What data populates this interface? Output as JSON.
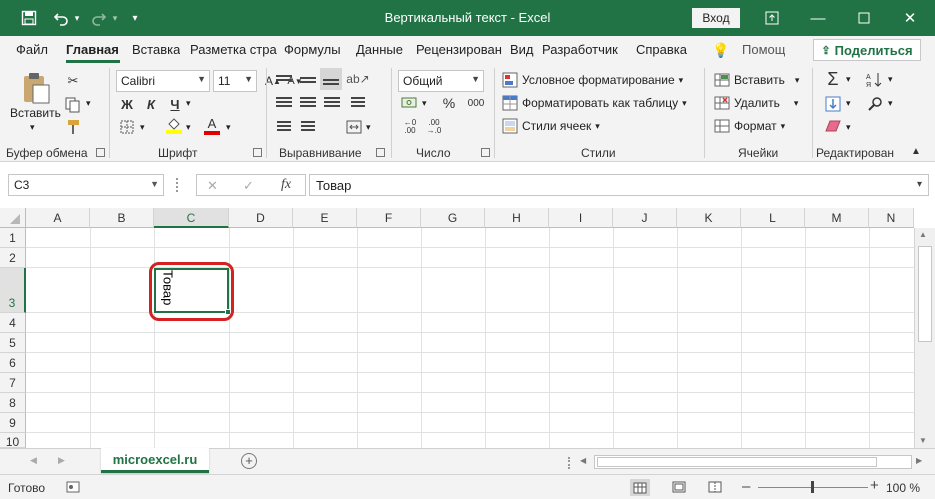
{
  "window": {
    "title": "Вертикальный текст  -  Excel",
    "login_label": "Вход",
    "accent": "#217346"
  },
  "tabs": [
    "Файл",
    "Главная",
    "Вставка",
    "Разметка стра",
    "Формулы",
    "Данные",
    "Рецензирован",
    "Вид",
    "Разработчик",
    "Справка"
  ],
  "tellme": "Помощ",
  "share_label": "Поделиться",
  "ribbon": {
    "clipboard": {
      "paste_label": "Вставить",
      "group": "Буфер обмена"
    },
    "font": {
      "name": "Calibri",
      "size": "11",
      "bold": "Ж",
      "italic": "К",
      "underline": "Ч",
      "group": "Шрифт"
    },
    "alignment": {
      "group": "Выравнивание"
    },
    "number": {
      "format": "Общий",
      "percent": "%",
      "thousands": "000",
      "group": "Число"
    },
    "styles": {
      "conditional": "Условное форматирование",
      "as_table": "Форматировать как таблицу",
      "cell_styles": "Стили ячеек",
      "group": "Стили"
    },
    "cells": {
      "insert": "Вставить",
      "delete": "Удалить",
      "format": "Формат",
      "group": "Ячейки"
    },
    "editing": {
      "group": "Редактирован"
    }
  },
  "formula_bar": {
    "name_box": "C3",
    "fx": "fx",
    "value": "Товар"
  },
  "grid": {
    "columns": [
      "A",
      "B",
      "C",
      "D",
      "E",
      "F",
      "G",
      "H",
      "I",
      "J",
      "K",
      "L",
      "M",
      "N"
    ],
    "rows": [
      "1",
      "2",
      "3",
      "4",
      "5",
      "6",
      "7",
      "8",
      "9",
      "10"
    ],
    "selected_cell": "C3",
    "cell_value": "Товар"
  },
  "sheet": {
    "name": "microexcel.ru"
  },
  "status": {
    "ready": "Готово",
    "zoom": "100 %"
  },
  "annotation_color": "#d42121"
}
